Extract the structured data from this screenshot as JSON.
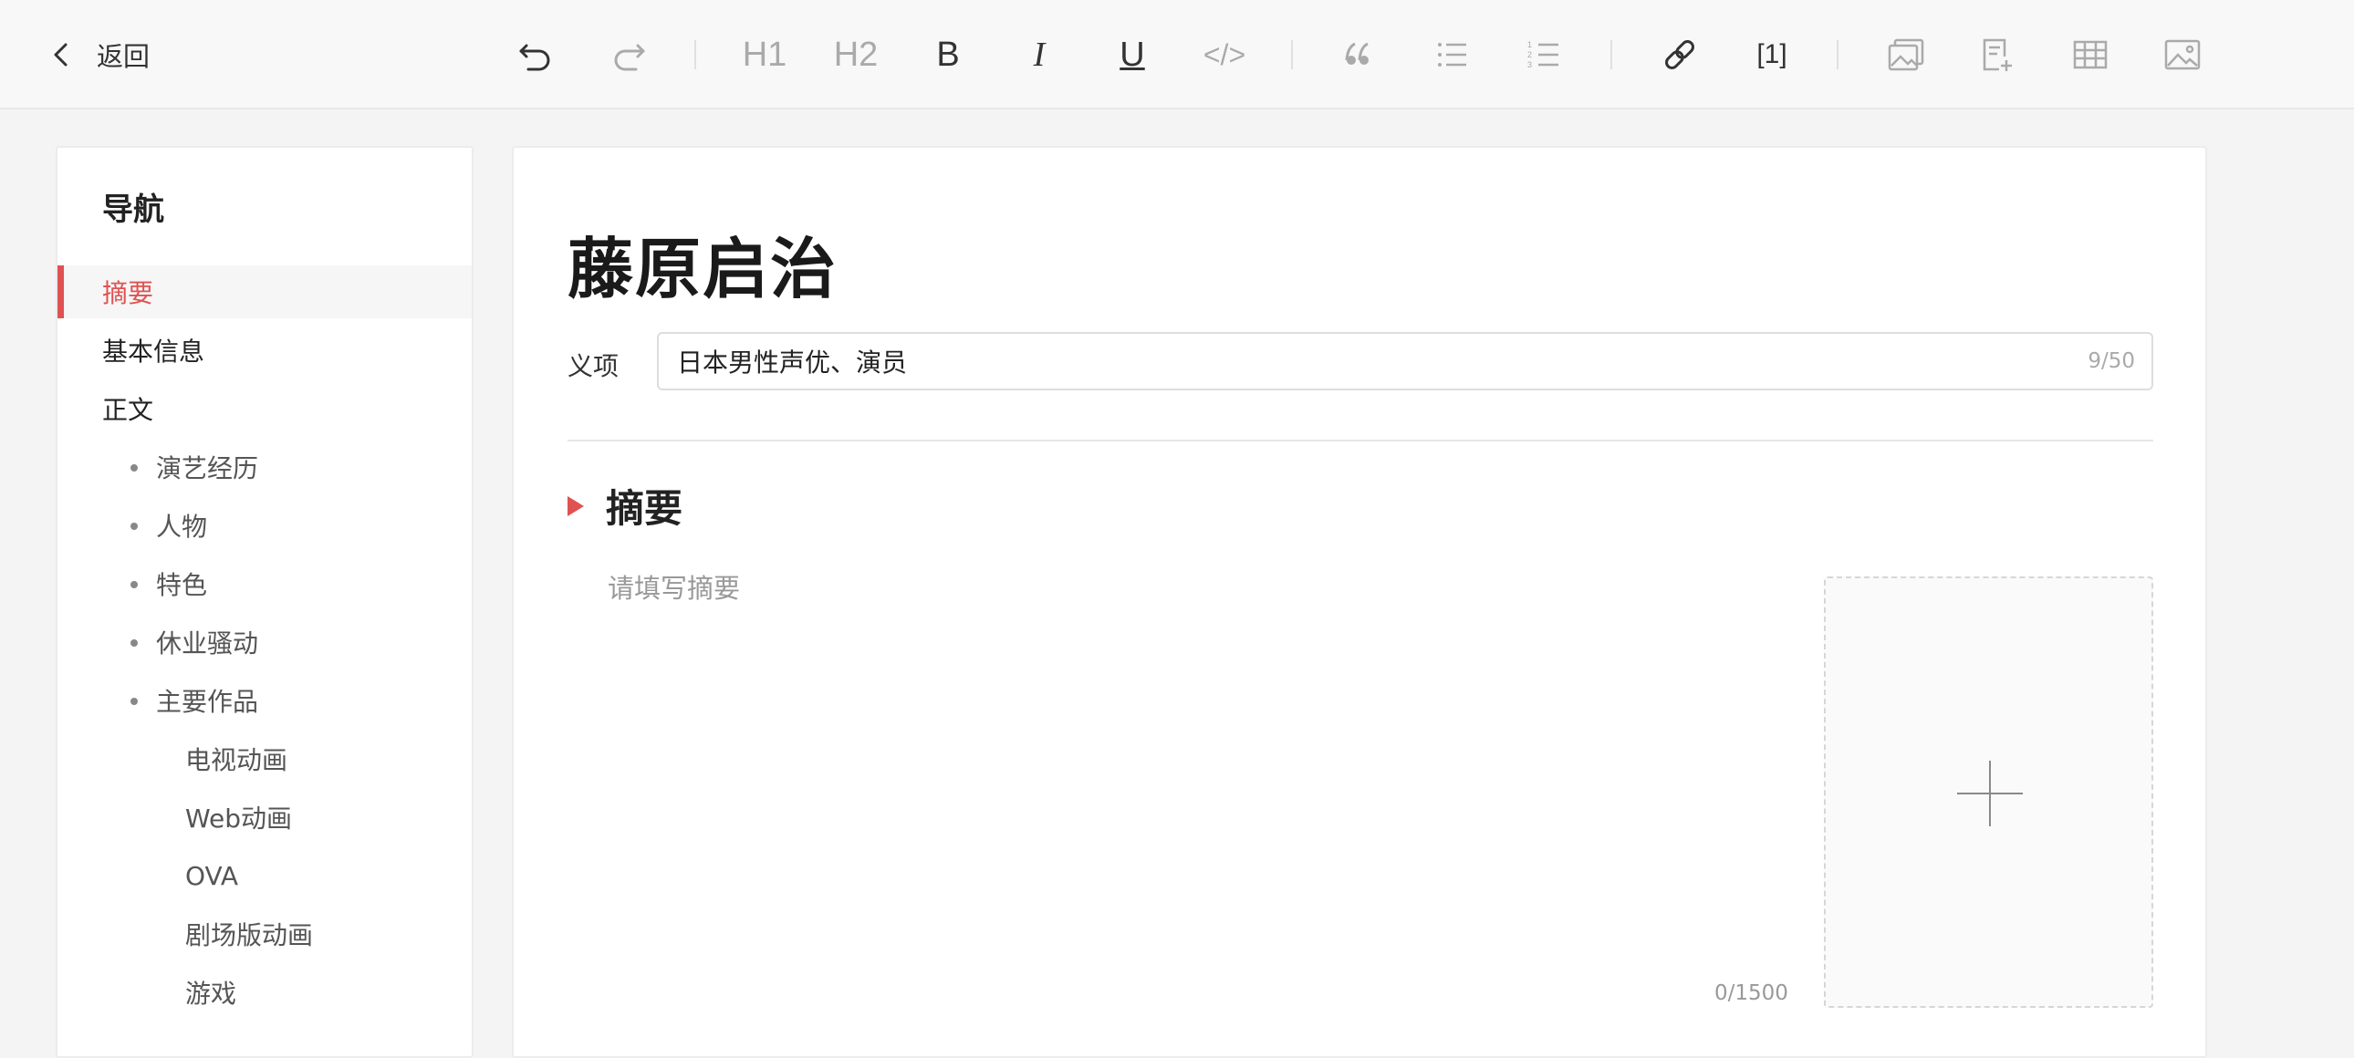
{
  "header": {
    "back_label": "返回",
    "toolbar": {
      "h1_label": "H1",
      "h2_label": "H2",
      "bold_label": "B",
      "italic_label": "I",
      "underline_label": "U",
      "code_label": "</>",
      "footnote_label": "[1]"
    }
  },
  "sidebar": {
    "title": "导航",
    "items": [
      {
        "label": "摘要"
      },
      {
        "label": "基本信息"
      },
      {
        "label": "正文"
      },
      {
        "label": "演艺经历"
      },
      {
        "label": "人物"
      },
      {
        "label": "特色"
      },
      {
        "label": "休业骚动"
      },
      {
        "label": "主要作品"
      },
      {
        "label": "电视动画"
      },
      {
        "label": "Web动画"
      },
      {
        "label": "OVA"
      },
      {
        "label": "剧场版动画"
      },
      {
        "label": "游戏"
      }
    ]
  },
  "editor": {
    "title": "藤原启治",
    "sense": {
      "label": "义项",
      "value": "日本男性声优、演员",
      "counter": "9/50"
    },
    "summary": {
      "heading": "摘要",
      "placeholder": "请填写摘要",
      "counter": "0/1500"
    }
  },
  "colors": {
    "accent": "#e05252",
    "icon_dark": "#333333",
    "icon_light": "#aaaaaa"
  }
}
